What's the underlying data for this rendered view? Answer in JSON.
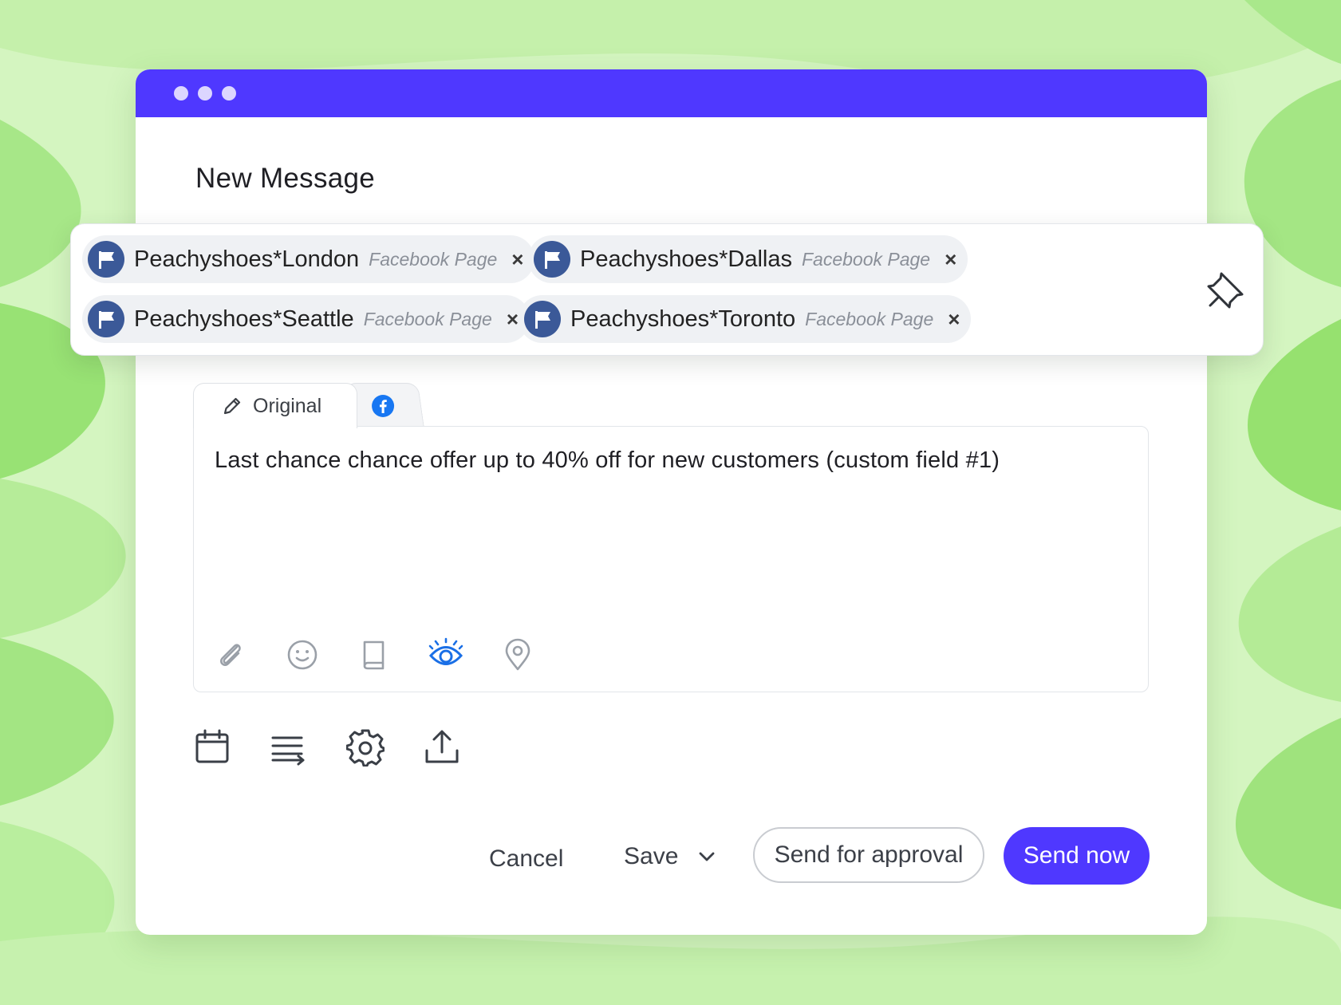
{
  "window": {
    "title": "New Message"
  },
  "recipients": [
    {
      "name": "Peachyshoes*London",
      "type": "Facebook Page"
    },
    {
      "name": "Peachyshoes*Dallas",
      "type": "Facebook Page"
    },
    {
      "name": "Peachyshoes*Seattle",
      "type": "Facebook Page"
    },
    {
      "name": "Peachyshoes*Toronto",
      "type": "Facebook Page"
    }
  ],
  "chip_remove_glyph": "×",
  "tabs": {
    "original_label": "Original"
  },
  "editor": {
    "text": "Last chance chance offer up to 40% off for new customers (custom field #1)",
    "tools": [
      "paperclip-icon",
      "emoji-icon",
      "book-icon",
      "eye-icon",
      "location-pin-icon"
    ]
  },
  "actions": [
    "calendar-icon",
    "text-wrap-icon",
    "gear-icon",
    "upload-icon"
  ],
  "footer": {
    "cancel_label": "Cancel",
    "save_label": "Save",
    "approval_label": "Send for approval",
    "send_label": "Send now"
  },
  "colors": {
    "brand": "#4f38ff",
    "facebook": "#3b5998",
    "facebook_tab": "#1877f2",
    "background": "#cdf3b5"
  }
}
